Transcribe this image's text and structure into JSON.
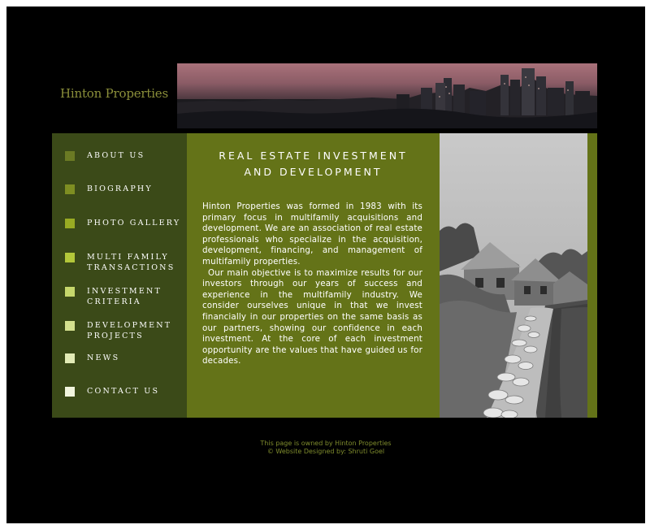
{
  "logo": {
    "text": "Hinton Properties"
  },
  "nav": {
    "items": [
      {
        "label": "ABOUT US",
        "color": "#6b7a24"
      },
      {
        "label": "BIOGRAPHY",
        "color": "#7e8e22"
      },
      {
        "label": "PHOTO GALLERY",
        "color": "#99ab23"
      },
      {
        "label": "MULTI FAMILY\nTRANSACTIONS",
        "color": "#b3c73a"
      },
      {
        "label": "INVESTMENT\nCRITERIA",
        "color": "#c6d76c"
      },
      {
        "label": "DEVELOPMENT\nPROJECTS",
        "color": "#d4e08f"
      },
      {
        "label": "NEWS",
        "color": "#e2ebb6"
      },
      {
        "label": "CONTACT US",
        "color": "#f1f5de"
      }
    ]
  },
  "main": {
    "title": "REAL ESTATE INVESTMENT\nAND DEVELOPMENT",
    "paragraph1": "Hinton Properties was formed in 1983 with its primary focus in multifamily acquisitions and development.   We are an association of real estate professionals who specialize in the acquisition, development, financing, and management of multifamily properties.",
    "paragraph2": "Our main objective is to maximize results for our investors through our years of success and experience in the multifamily industry.  We consider ourselves unique in that we invest financially in our properties on the same basis as our partners, showing our confidence in each investment.  At the core of each investment opportunity are the values that have guided us for decades."
  },
  "footer": {
    "line1": "This page is owned by Hinton Properties",
    "line2": "© Website Designed by: Shruti Goel"
  },
  "colors": {
    "background": "#000000",
    "sidebar": "#3b4a18",
    "main_panel": "#647318",
    "footer_text": "#7f8c2d",
    "logo_text": "#8b8f3a"
  },
  "images": {
    "header": "city-skyline-at-dusk",
    "side_photo": "houses-and-cobblestone-path-grayscale"
  }
}
